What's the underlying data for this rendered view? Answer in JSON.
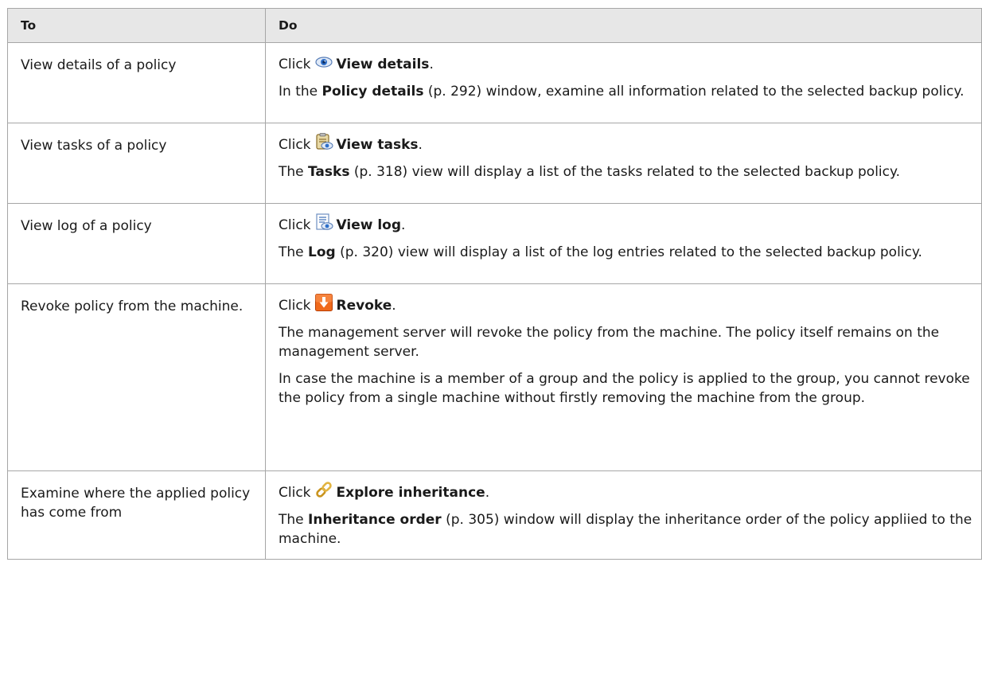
{
  "header": {
    "to": "To",
    "do": "Do"
  },
  "rows": [
    {
      "to": "View details of a policy",
      "action_prefix": "Click",
      "action_icon": "eye-icon",
      "action": "View details",
      "action_suffix": ".",
      "desc": [
        {
          "pre": "In the ",
          "bold": "Policy details",
          "ref": " (p. 292)",
          "post": " window, examine all information related to the selected backup policy."
        }
      ]
    },
    {
      "to": "View tasks of a policy",
      "action_prefix": "Click",
      "action_icon": "tasks-view-icon",
      "action": "View tasks",
      "action_suffix": ".",
      "desc": [
        {
          "pre": "The ",
          "bold": "Tasks",
          "ref": " (p. 318)",
          "post": " view will display a list of the tasks related to the selected backup policy."
        }
      ]
    },
    {
      "to": "View log of a policy",
      "action_prefix": "Click",
      "action_icon": "log-view-icon",
      "action": "View log",
      "action_suffix": ".",
      "desc": [
        {
          "pre": "The ",
          "bold": "Log",
          "ref": " (p. 320)",
          "post": " view will display a list of the log entries related to the selected backup policy."
        }
      ]
    },
    {
      "to": "Revoke policy from the machine.",
      "action_prefix": "Click",
      "action_icon": "revoke-icon",
      "action": "Revoke",
      "action_suffix": ".",
      "desc": [
        {
          "text": "The management server will revoke the policy from the machine. The policy itself remains on the management server."
        },
        {
          "text": "In case the machine is a member of a group and the policy is applied to the group, you cannot revoke the policy from a single machine without firstly removing the machine from the group."
        }
      ]
    },
    {
      "to": "Examine where the applied policy has come from",
      "action_prefix": "Click",
      "action_icon": "chain-link-icon",
      "action": "Explore inheritance",
      "action_suffix": ".",
      "desc": [
        {
          "pre": "The ",
          "bold": "Inheritance order",
          "ref": " (p. 305)",
          "post": " window will display the inheritance order of the policy appliied to the machine."
        }
      ]
    }
  ]
}
